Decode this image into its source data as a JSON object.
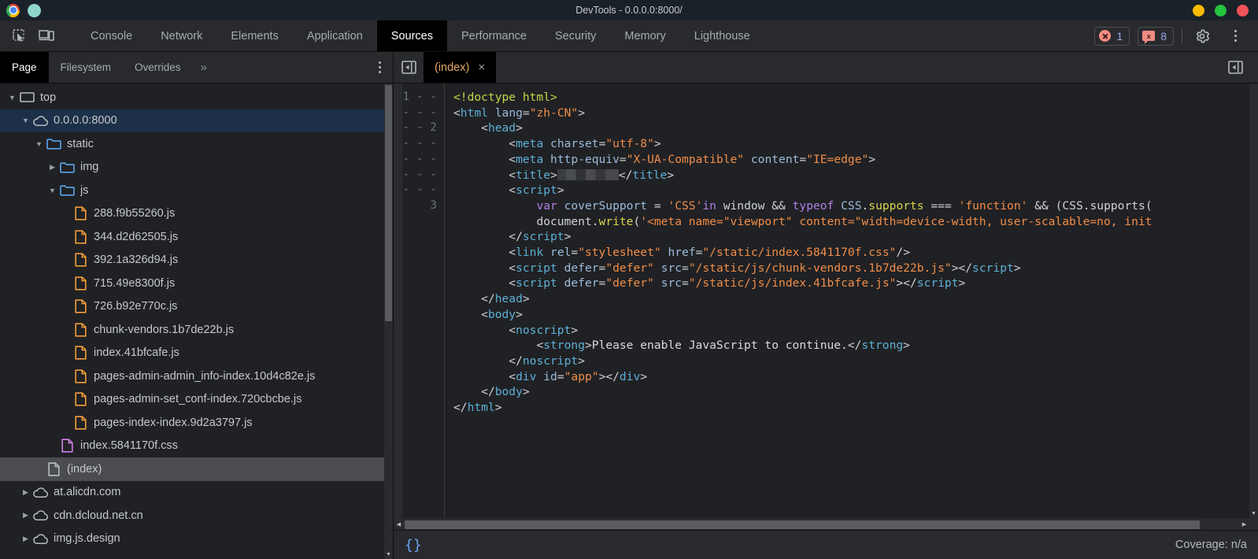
{
  "window": {
    "title": "DevTools - 0.0.0.0:8000/",
    "controls": {
      "minimize": "minimize",
      "maximize": "maximize",
      "close": "close"
    }
  },
  "toolbar": {
    "inspect_icon": "inspect-element-icon",
    "device_icon": "device-toolbar-icon",
    "tabs": [
      {
        "label": "Console",
        "active": false
      },
      {
        "label": "Network",
        "active": false
      },
      {
        "label": "Elements",
        "active": false
      },
      {
        "label": "Application",
        "active": false
      },
      {
        "label": "Sources",
        "active": true
      },
      {
        "label": "Performance",
        "active": false
      },
      {
        "label": "Security",
        "active": false
      },
      {
        "label": "Memory",
        "active": false
      },
      {
        "label": "Lighthouse",
        "active": false
      }
    ],
    "error_count": "1",
    "warning_count": "8",
    "warning_glyph": "x",
    "settings_icon": "gear-icon",
    "menu_icon": "kebab-menu-icon"
  },
  "navigator": {
    "tabs": [
      {
        "label": "Page",
        "active": true
      },
      {
        "label": "Filesystem",
        "active": false
      },
      {
        "label": "Overrides",
        "active": false
      }
    ],
    "more_label": "»",
    "menu_icon": "kebab-menu-icon",
    "tree": [
      {
        "label": "top",
        "indent": 0,
        "twisty": "down",
        "icon": "frame-icon",
        "state": "normal"
      },
      {
        "label": "0.0.0.0:8000",
        "indent": 1,
        "twisty": "down",
        "icon": "cloud-icon",
        "state": "selected-blue"
      },
      {
        "label": "static",
        "indent": 2,
        "twisty": "down",
        "icon": "folder-icon",
        "state": "normal"
      },
      {
        "label": "img",
        "indent": 3,
        "twisty": "right",
        "icon": "folder-icon",
        "state": "normal"
      },
      {
        "label": "js",
        "indent": 3,
        "twisty": "down",
        "icon": "folder-icon",
        "state": "normal"
      },
      {
        "label": "288.f9b55260.js",
        "indent": 4,
        "twisty": "none",
        "icon": "js-file-icon",
        "state": "normal"
      },
      {
        "label": "344.d2d62505.js",
        "indent": 4,
        "twisty": "none",
        "icon": "js-file-icon",
        "state": "normal"
      },
      {
        "label": "392.1a326d94.js",
        "indent": 4,
        "twisty": "none",
        "icon": "js-file-icon",
        "state": "normal"
      },
      {
        "label": "715.49e8300f.js",
        "indent": 4,
        "twisty": "none",
        "icon": "js-file-icon",
        "state": "normal"
      },
      {
        "label": "726.b92e770c.js",
        "indent": 4,
        "twisty": "none",
        "icon": "js-file-icon",
        "state": "normal"
      },
      {
        "label": "chunk-vendors.1b7de22b.js",
        "indent": 4,
        "twisty": "none",
        "icon": "js-file-icon",
        "state": "normal"
      },
      {
        "label": "index.41bfcafe.js",
        "indent": 4,
        "twisty": "none",
        "icon": "js-file-icon",
        "state": "normal"
      },
      {
        "label": "pages-admin-admin_info-index.10d4c82e.js",
        "indent": 4,
        "twisty": "none",
        "icon": "js-file-icon",
        "state": "normal"
      },
      {
        "label": "pages-admin-set_conf-index.720cbcbe.js",
        "indent": 4,
        "twisty": "none",
        "icon": "js-file-icon",
        "state": "normal"
      },
      {
        "label": "pages-index-index.9d2a3797.js",
        "indent": 4,
        "twisty": "none",
        "icon": "js-file-icon",
        "state": "normal"
      },
      {
        "label": "index.5841170f.css",
        "indent": 3,
        "twisty": "none",
        "icon": "css-file-icon",
        "state": "normal"
      },
      {
        "label": "(index)",
        "indent": 2,
        "twisty": "none",
        "icon": "doc-file-icon",
        "state": "selected-gray"
      },
      {
        "label": "at.alicdn.com",
        "indent": 1,
        "twisty": "right",
        "icon": "cloud-icon",
        "state": "normal"
      },
      {
        "label": "cdn.dcloud.net.cn",
        "indent": 1,
        "twisty": "right",
        "icon": "cloud-icon",
        "state": "normal"
      },
      {
        "label": "img.js.design",
        "indent": 1,
        "twisty": "right",
        "icon": "cloud-icon",
        "state": "normal"
      }
    ]
  },
  "editor": {
    "collapse_icon": "collapse-navigator-icon",
    "expand_icon": "show-debugger-sidebar-icon",
    "tab": {
      "name": "(index)",
      "close": "×"
    },
    "gutter": [
      "1",
      "-",
      "-",
      "-",
      "-",
      "-",
      "-",
      "-",
      "2",
      "-",
      "-",
      "-",
      "-",
      "-",
      "-",
      "-",
      "-",
      "-",
      "-",
      "-",
      "-",
      "3"
    ],
    "pretty_print_icon": "{}",
    "coverage": "Coverage: n/a"
  }
}
